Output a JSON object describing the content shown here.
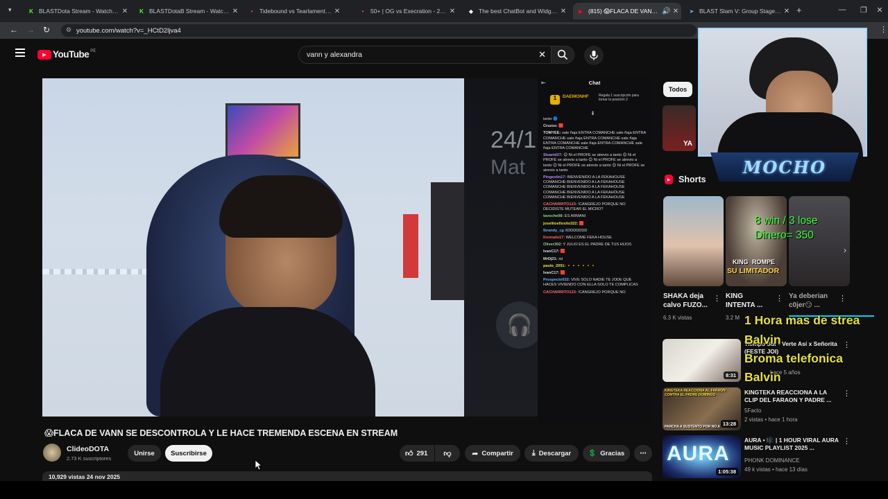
{
  "browser": {
    "tabs": [
      {
        "title": "BLASTDota Stream - Watch Live",
        "icon": "K"
      },
      {
        "title": "BLASTDotaB Stream - Watch Live",
        "icon": "K"
      },
      {
        "title": "Tidebound vs Tearlaments - 25/11",
        "icon": "•"
      },
      {
        "title": "50+ | OG vs Execration - 25/11",
        "icon": "•"
      },
      {
        "title": "The best ChatBot and Widgets",
        "icon": "◆"
      },
      {
        "title": "(815) 😱FLACA DE VANN SE",
        "icon": "▶"
      },
      {
        "title": "BLAST Slam V: Group Stage - Liqu",
        "icon": "➤"
      }
    ],
    "url": "youtube.com/watch?v=_HCtD2ljva4"
  },
  "youtube": {
    "logo": "YouTube",
    "region": "PE",
    "search_value": "vann y alexandra"
  },
  "video": {
    "title": "😱FLACA DE VANN SE DESCONTROLA Y LE HACE TREMENDA ESCENA EN STREAM",
    "side_text_1": "24/1",
    "side_text_2": "Mat",
    "views_date": "10,929 vistas  24 nov 2025"
  },
  "chat": {
    "header": "Chat",
    "pinned_user": "DAEMONHF",
    "pinned_text": "Regala 1 suscripción para tomar la posición 2",
    "lines": [
      {
        "user": "",
        "color": "#dedede",
        "text": "tanto 🔵"
      },
      {
        "user": "Cruzos:",
        "color": "#dedede",
        "text": "🟥"
      },
      {
        "user": "TOMYEE:",
        "color": "#dedede",
        "text": "sale ñaja ENTRA COMANCHE sale ñaja ENTRA COMANCHE sale ñaja ENTRA COMANCHE sale ñaja ENTRA COMANCHE sale ñaja ENTRA COMANCHE sale ñaja ENTRA COMANCHE"
      },
      {
        "user": "Stuartd27:",
        "color": "#b48cff",
        "text": "😊 Ni el PROFE se atrevio a tanto 😊 Ni el PROFE se atrevio a tanto 😊 Ni el PROFE se atrevio a tanto 😊 Ni el PROFE se atrevio a tanto 😊 Ni el PROFE se atrevio a tanto"
      },
      {
        "user": "Pingestin17:",
        "color": "#b48cff",
        "text": "BIENVENIDO A LA FEKAHOUSE COMANCHE BIENVENIDO A LA FEKAHOUSE COMANCHE BIENVENIDO A LA FEKAHOUSE COMANCHE BIENVENIDO A LA FEKAHOUSE COMANCHE BIENVENIDO A LA FEKAHOUSE"
      },
      {
        "user": "CACHARRITO123:",
        "color": "#ff6a6a",
        "text": "!CANGREJO PORQUE NO DECIDISTE MUTEAR EL MICRO?"
      },
      {
        "user": "tavoche08:",
        "color": "#8fd18f",
        "text": "ES ARMANI"
      },
      {
        "user": "joselitoelloxito322:",
        "color": "#e6e233",
        "text": "🟥"
      },
      {
        "user": "Ibrandy_cg",
        "color": "#6ab0ff",
        "text": "XDDDDDDD"
      },
      {
        "user": "Konrado17:",
        "color": "#ff6a6a",
        "text": "WELCOME FEKA HOUSE"
      },
      {
        "user": "Oliver302:",
        "color": "#8fd18f",
        "text": "Y JULIO ES EL PADRE DE TUS HIJOS"
      },
      {
        "user": "IvanC17:",
        "color": "#dedede",
        "text": "🟥"
      },
      {
        "user": "MrDj21:",
        "color": "#dedede",
        "text": "xd"
      },
      {
        "user": "paulo_2091:",
        "color": "#e6e233",
        "text": "🔸🔸🔸🔸🔸🔸"
      },
      {
        "user": "IvanC17:",
        "color": "#dedede",
        "text": "🟥"
      },
      {
        "user": "Prospecto032:",
        "color": "#6ab0ff",
        "text": "VIVE SOLO NADIE TE JODE QUE HACES VIVIENDO CON ELLA SOLO TE COMPLICAS"
      },
      {
        "user": "CACHARRITO123:",
        "color": "#ff6a6a",
        "text": "!CANGREJO PORQUE NO"
      }
    ]
  },
  "channel": {
    "name": "ClideoDOTA",
    "subs": "2.73 K suscriptores",
    "join_label": "Unirse",
    "subscribe_label": "Suscribirse"
  },
  "actions": {
    "likes": "291",
    "share": "Compartir",
    "download": "Descargar",
    "thanks": "Gracias"
  },
  "sidebar": {
    "chip": "Todos",
    "shorts_header": "Shorts",
    "shorts": [
      {
        "title": "SHAKA deja calvo FUZO...",
        "views": "6.3 K vistas"
      },
      {
        "title": "KING INTENTA ...",
        "views": "3.2 M"
      },
      {
        "title": "Ya deberian c0jer😏 ...",
        "views": ""
      }
    ],
    "short2_caption_1": "KING",
    "short2_caption_2": "ROMPE",
    "short2_caption_3": "SU LIMITADOR",
    "videos": [
      {
        "title": "Tiempo Sur - Verte Así x Señorita (FESTE JOI)",
        "meta1": "",
        "meta2": "hace 5 años",
        "duration": "8:31"
      },
      {
        "title": "KINGTEKA REACCIONA A LA CLIP DEL FARAON Y PADRE ...",
        "meta1": "5Facto",
        "meta2": "2 vistas • hace 1 hora",
        "duration": "13:28"
      },
      {
        "title": "AURA • 🎼 | 1 HOUR VIRAL AURA MUSIC PLAYLIST 2025 ...",
        "meta1": "PHONK DOMINANCE",
        "meta2": "49 k vistas • hace 13 días",
        "duration": "1:05:38"
      }
    ],
    "thumb2_caption": "KINGTEKA REACCIONA AL FARAON CONTRA EL PADRE DOMINGO",
    "thumb2_caption_b": "PARCHA A SUSTENTO POR NO A",
    "thumb3_caption": "AURA"
  },
  "overlays": {
    "webcam_name": "MOCHO",
    "stats_line1": "8 win / 3 lose",
    "stats_line2": "Dinero= 350",
    "yellow_1": "1 Hora mas de strea",
    "yellow_2": "Balvin",
    "yellow_3": "Broma telefonica",
    "yellow_4": "Balvin"
  }
}
